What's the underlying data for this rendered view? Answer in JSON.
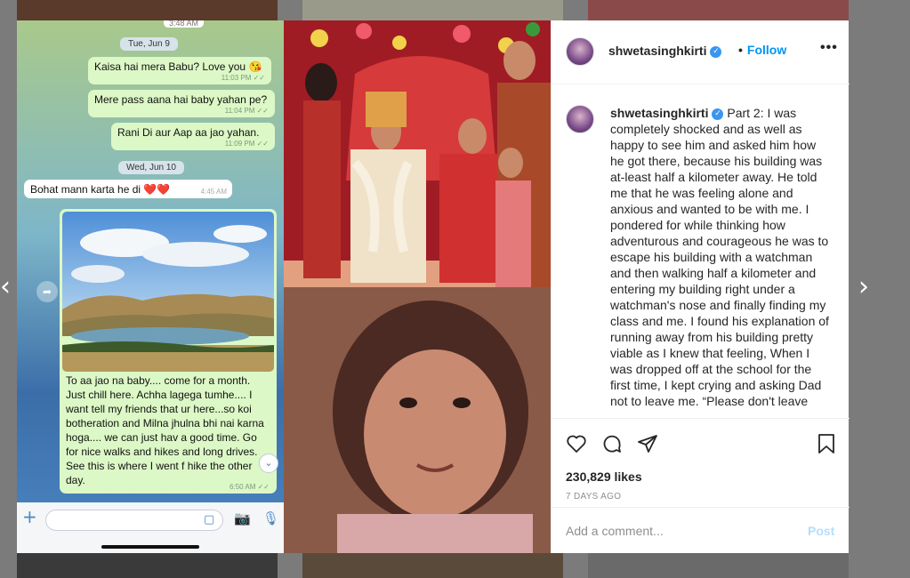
{
  "background": {
    "prev_arrow": "‹",
    "next_arrow": "›"
  },
  "chat": {
    "top_time": "3:48 AM",
    "dates": [
      "Tue, Jun 9",
      "Wed, Jun 10"
    ],
    "messages": [
      {
        "text": "Kaisa hai mera Babu? Love you 😘",
        "time": "11:03 PM ✓✓"
      },
      {
        "text": "Mere pass aana hai baby yahan pe?",
        "time": "11:04 PM ✓✓"
      },
      {
        "text": "Rani Di aur Aap aa jao yahan.",
        "time": "11:09 PM ✓✓"
      },
      {
        "text": "Bohat mann karta he di ❤️❤️",
        "time": "4:45 AM"
      }
    ],
    "image_caption": "To aa jao na baby.... come for a month. Just chill here. Achha lagega tumhe.... I want tell my friends that ur here...so koi botheration and Milna jhulna bhi nai karna hoga.... we can just hav a good time. Go for nice walks and hikes and long drives. See this is where I went f hike the other day.",
    "image_time": "6:50 AM ✓✓"
  },
  "post": {
    "username": "shwetasinghkirti",
    "follow_label": "Follow",
    "more_label": "•••",
    "caption_prefix": "Part 2:",
    "caption": "I was completely shocked and as well as happy to see him and asked him how he got there, because his building was at-least half a kilometer away. He told me that he was feeling alone and anxious and wanted to be with me. I pondered for while thinking how adventurous and courageous he was to escape his building with a watchman and then walking half a kilometer and entering my building right under a watchman's nose and finally finding my class and me. I found his explanation of running away from his building pretty viable as I knew that feeling, When I was dropped off at the school for the first time, I kept crying and asking Dad not to leave me. “Please don't leave",
    "likes": "230,829 likes",
    "date": "7 DAYS AGO",
    "comment_placeholder": "Add a comment...",
    "post_label": "Post"
  },
  "icons": [
    "heart-icon",
    "comment-icon",
    "share-icon",
    "bookmark-icon",
    "verified-icon",
    "more-icon"
  ],
  "colors": {
    "link": "#0095f6",
    "verified": "#3897f0",
    "post_disabled": "#b2dffc"
  }
}
